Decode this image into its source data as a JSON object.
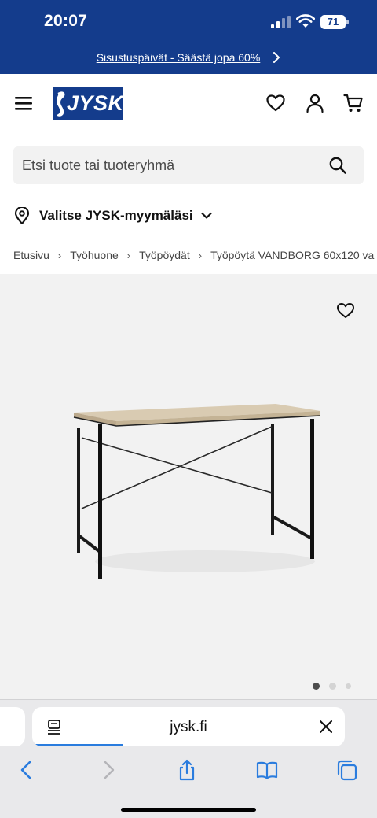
{
  "status_bar": {
    "time": "20:07",
    "battery": "71"
  },
  "promo": {
    "text": "Sisustuspäivät - Säästä jopa 60%"
  },
  "header": {
    "logo_text": "JYSK"
  },
  "search": {
    "placeholder": "Etsi tuote tai tuoteryhmä"
  },
  "store": {
    "label": "Valitse JYSK-myymäläsi"
  },
  "breadcrumb": {
    "items": [
      "Etusivu",
      "Työhuone",
      "Työpöydät",
      "Työpöytä VANDBORG 60x120 va"
    ],
    "separator": "›"
  },
  "gallery": {
    "image_count": 3,
    "active_index": 0
  },
  "browser": {
    "url": "jysk.fi",
    "load_progress": 0.29
  },
  "colors": {
    "brand": "#143c8c",
    "background_gallery": "#f2f2f2",
    "progress": "#2a7cde"
  }
}
